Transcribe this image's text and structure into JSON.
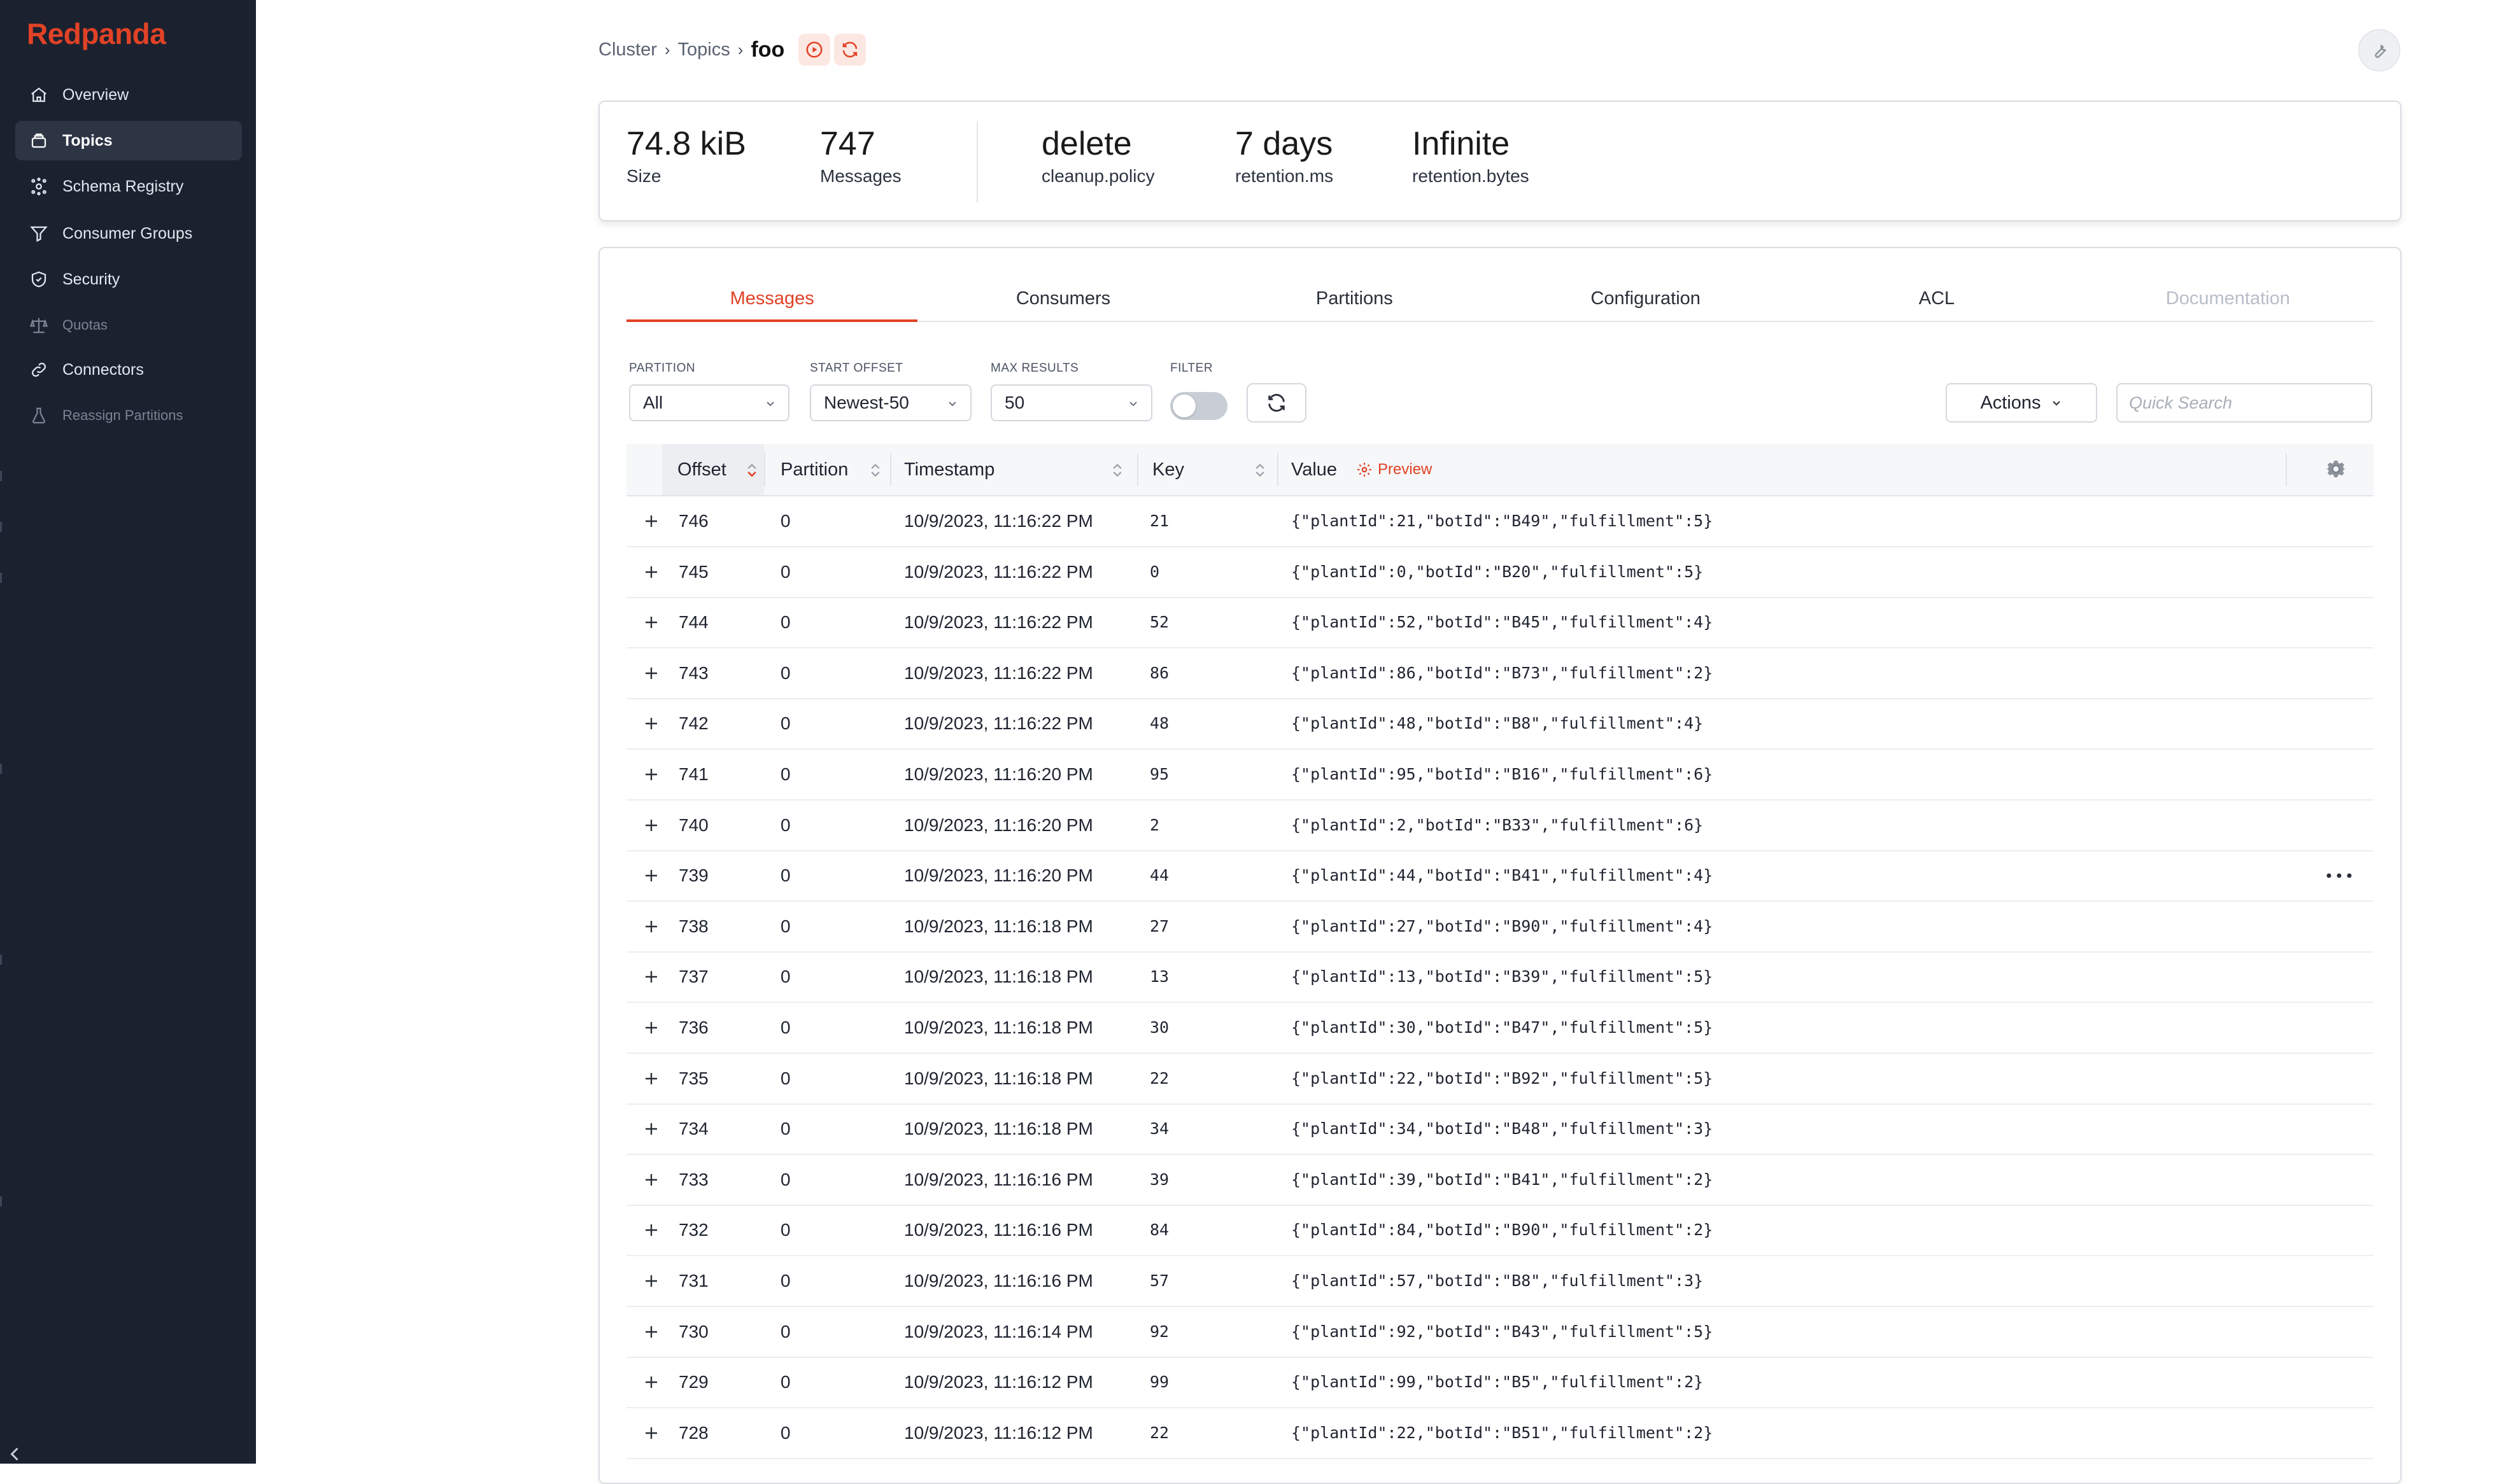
{
  "app": {
    "logo": "Redpanda",
    "brand_color": "#e14226"
  },
  "sidebar": {
    "items": [
      {
        "label": "Overview",
        "icon": "home-icon",
        "active": false,
        "disabled": false
      },
      {
        "label": "Topics",
        "icon": "topics-icon",
        "active": true,
        "disabled": false
      },
      {
        "label": "Schema Registry",
        "icon": "schema-icon",
        "active": false,
        "disabled": false
      },
      {
        "label": "Consumer Groups",
        "icon": "funnel-icon",
        "active": false,
        "disabled": false
      },
      {
        "label": "Security",
        "icon": "shield-icon",
        "active": false,
        "disabled": false
      },
      {
        "label": "Quotas",
        "icon": "scale-icon",
        "active": false,
        "disabled": true
      },
      {
        "label": "Connectors",
        "icon": "link-icon",
        "active": false,
        "disabled": false
      },
      {
        "label": "Reassign Partitions",
        "icon": "beaker-icon",
        "active": false,
        "disabled": true
      }
    ]
  },
  "breadcrumb": {
    "items": [
      "Cluster",
      "Topics"
    ],
    "current": "foo"
  },
  "stats": {
    "size": {
      "value": "74.8 kiB",
      "label": "Size"
    },
    "messages": {
      "value": "747",
      "label": "Messages"
    },
    "cleanup": {
      "value": "delete",
      "label": "cleanup.policy"
    },
    "retention_ms": {
      "value": "7 days",
      "label": "retention.ms"
    },
    "retention_bytes": {
      "value": "Infinite",
      "label": "retention.bytes"
    }
  },
  "tabs": [
    {
      "label": "Messages",
      "active": true
    },
    {
      "label": "Consumers"
    },
    {
      "label": "Partitions"
    },
    {
      "label": "Configuration"
    },
    {
      "label": "ACL"
    },
    {
      "label": "Documentation",
      "disabled": true
    }
  ],
  "filters": {
    "partition": {
      "label": "PARTITION",
      "value": "All"
    },
    "start_offset": {
      "label": "START OFFSET",
      "value": "Newest-50"
    },
    "max_results": {
      "label": "MAX RESULTS",
      "value": "50"
    },
    "filter": {
      "label": "FILTER",
      "enabled": false
    },
    "actions_label": "Actions",
    "search_placeholder": "Quick Search"
  },
  "table": {
    "headers": {
      "offset": "Offset",
      "partition": "Partition",
      "timestamp": "Timestamp",
      "key": "Key",
      "value": "Value",
      "preview": "Preview"
    },
    "rows": [
      {
        "offset": "746",
        "partition": "0",
        "timestamp": "10/9/2023, 11:16:22 PM",
        "key": "21",
        "value": "{\"plantId\":21,\"botId\":\"B49\",\"fulfillment\":5}"
      },
      {
        "offset": "745",
        "partition": "0",
        "timestamp": "10/9/2023, 11:16:22 PM",
        "key": "0",
        "value": "{\"plantId\":0,\"botId\":\"B20\",\"fulfillment\":5}"
      },
      {
        "offset": "744",
        "partition": "0",
        "timestamp": "10/9/2023, 11:16:22 PM",
        "key": "52",
        "value": "{\"plantId\":52,\"botId\":\"B45\",\"fulfillment\":4}"
      },
      {
        "offset": "743",
        "partition": "0",
        "timestamp": "10/9/2023, 11:16:22 PM",
        "key": "86",
        "value": "{\"plantId\":86,\"botId\":\"B73\",\"fulfillment\":2}"
      },
      {
        "offset": "742",
        "partition": "0",
        "timestamp": "10/9/2023, 11:16:22 PM",
        "key": "48",
        "value": "{\"plantId\":48,\"botId\":\"B8\",\"fulfillment\":4}"
      },
      {
        "offset": "741",
        "partition": "0",
        "timestamp": "10/9/2023, 11:16:20 PM",
        "key": "95",
        "value": "{\"plantId\":95,\"botId\":\"B16\",\"fulfillment\":6}"
      },
      {
        "offset": "740",
        "partition": "0",
        "timestamp": "10/9/2023, 11:16:20 PM",
        "key": "2",
        "value": "{\"plantId\":2,\"botId\":\"B33\",\"fulfillment\":6}"
      },
      {
        "offset": "739",
        "partition": "0",
        "timestamp": "10/9/2023, 11:16:20 PM",
        "key": "44",
        "value": "{\"plantId\":44,\"botId\":\"B41\",\"fulfillment\":4}"
      },
      {
        "offset": "738",
        "partition": "0",
        "timestamp": "10/9/2023, 11:16:18 PM",
        "key": "27",
        "value": "{\"plantId\":27,\"botId\":\"B90\",\"fulfillment\":4}"
      },
      {
        "offset": "737",
        "partition": "0",
        "timestamp": "10/9/2023, 11:16:18 PM",
        "key": "13",
        "value": "{\"plantId\":13,\"botId\":\"B39\",\"fulfillment\":5}"
      },
      {
        "offset": "736",
        "partition": "0",
        "timestamp": "10/9/2023, 11:16:18 PM",
        "key": "30",
        "value": "{\"plantId\":30,\"botId\":\"B47\",\"fulfillment\":5}"
      },
      {
        "offset": "735",
        "partition": "0",
        "timestamp": "10/9/2023, 11:16:18 PM",
        "key": "22",
        "value": "{\"plantId\":22,\"botId\":\"B92\",\"fulfillment\":5}"
      },
      {
        "offset": "734",
        "partition": "0",
        "timestamp": "10/9/2023, 11:16:18 PM",
        "key": "34",
        "value": "{\"plantId\":34,\"botId\":\"B48\",\"fulfillment\":3}"
      },
      {
        "offset": "733",
        "partition": "0",
        "timestamp": "10/9/2023, 11:16:16 PM",
        "key": "39",
        "value": "{\"plantId\":39,\"botId\":\"B41\",\"fulfillment\":2}"
      },
      {
        "offset": "732",
        "partition": "0",
        "timestamp": "10/9/2023, 11:16:16 PM",
        "key": "84",
        "value": "{\"plantId\":84,\"botId\":\"B90\",\"fulfillment\":2}"
      },
      {
        "offset": "731",
        "partition": "0",
        "timestamp": "10/9/2023, 11:16:16 PM",
        "key": "57",
        "value": "{\"plantId\":57,\"botId\":\"B8\",\"fulfillment\":3}"
      },
      {
        "offset": "730",
        "partition": "0",
        "timestamp": "10/9/2023, 11:16:14 PM",
        "key": "92",
        "value": "{\"plantId\":92,\"botId\":\"B43\",\"fulfillment\":5}"
      },
      {
        "offset": "729",
        "partition": "0",
        "timestamp": "10/9/2023, 11:16:12 PM",
        "key": "99",
        "value": "{\"plantId\":99,\"botId\":\"B5\",\"fulfillment\":2}"
      },
      {
        "offset": "728",
        "partition": "0",
        "timestamp": "10/9/2023, 11:16:12 PM",
        "key": "22",
        "value": "{\"plantId\":22,\"botId\":\"B51\",\"fulfillment\":2}"
      }
    ]
  }
}
